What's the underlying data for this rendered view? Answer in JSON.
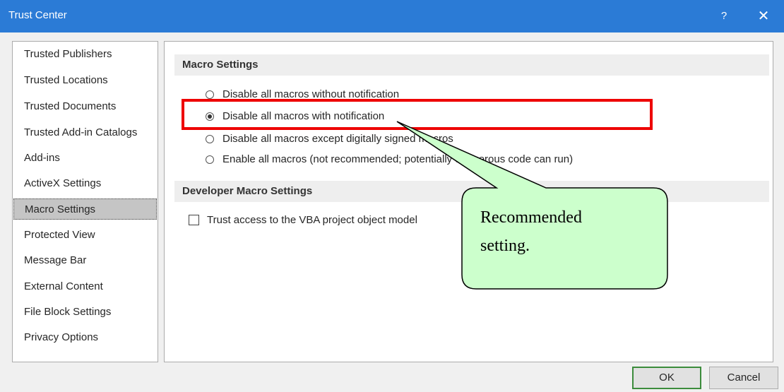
{
  "window": {
    "title": "Trust Center",
    "help_label": "?",
    "close_label": "✕"
  },
  "nav": {
    "items": [
      {
        "label": "Trusted Publishers"
      },
      {
        "label": "Trusted Locations"
      },
      {
        "label": "Trusted Documents"
      },
      {
        "label": "Trusted Add-in Catalogs"
      },
      {
        "label": "Add-ins"
      },
      {
        "label": "ActiveX Settings"
      },
      {
        "label": "Macro Settings",
        "selected": true
      },
      {
        "label": "Protected View"
      },
      {
        "label": "Message Bar"
      },
      {
        "label": "External Content"
      },
      {
        "label": "File Block Settings"
      },
      {
        "label": "Privacy Options"
      }
    ]
  },
  "macro_settings": {
    "header": "Macro Settings",
    "options": [
      {
        "label": "Disable all macros without notification",
        "selected": false
      },
      {
        "label": "Disable all macros with notification",
        "selected": true
      },
      {
        "label": "Disable all macros except digitally signed macros",
        "selected": false
      },
      {
        "label": "Enable all macros (not recommended; potentially dangerous code can run)",
        "selected": false
      }
    ]
  },
  "developer_settings": {
    "header": "Developer Macro Settings",
    "vba_access_label": "Trust access to the VBA project object model",
    "vba_access_checked": false
  },
  "callout": {
    "line1": "Recommended",
    "line2": "setting."
  },
  "buttons": {
    "ok": "OK",
    "cancel": "Cancel"
  },
  "colors": {
    "titlebar": "#2b7bd6",
    "highlight": "#ee0000",
    "callout_fill": "#ccffcc",
    "ok_border": "#3c8c3c"
  }
}
